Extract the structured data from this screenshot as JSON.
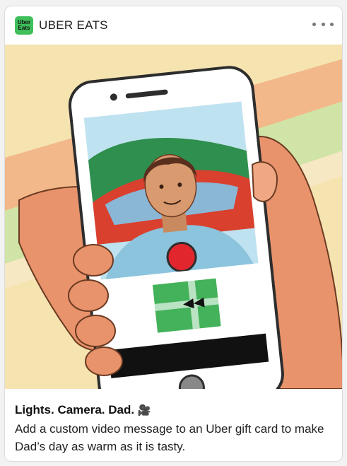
{
  "ad": {
    "brand_name": "UBER EATS",
    "logo_text_line1": "Uber",
    "logo_text_line2": "Eats",
    "more_icon": "more-dots-icon",
    "headline": "Lights. Camera. Dad.",
    "headline_emoji": "🎥",
    "body": "Add a custom video message to an Uber gift card to make Dad’s day as warm as it is tasty."
  },
  "colors": {
    "brand_green": "#3fbf5a",
    "background_yellow": "#f5e3b0",
    "stripe_green": "#cfe4a6",
    "stripe_orange": "#f2a977",
    "record_red": "#e2262d"
  }
}
